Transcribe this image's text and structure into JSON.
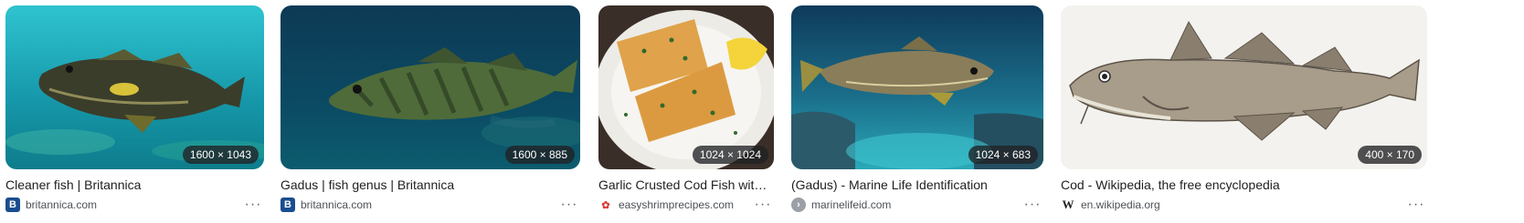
{
  "results": [
    {
      "dimensions": "1600 × 1043",
      "title": "Cleaner fish | Britannica",
      "source": "britannica.com",
      "favicon_glyph": "B",
      "favicon_bg": "#1a4d8f",
      "favicon_fg": "#ffffff",
      "favicon_icon": "britannica-favicon-icon"
    },
    {
      "dimensions": "1600 × 885",
      "title": "Gadus | fish genus | Britannica",
      "source": "britannica.com",
      "favicon_glyph": "B",
      "favicon_bg": "#1a4d8f",
      "favicon_fg": "#ffffff",
      "favicon_icon": "britannica-favicon-icon"
    },
    {
      "dimensions": "1024 × 1024",
      "title": "Garlic Crusted Cod Fish with a Li...",
      "source": "easyshrimprecipes.com",
      "favicon_glyph": "✿",
      "favicon_bg": "#ffffff",
      "favicon_fg": "#d93a3a",
      "favicon_icon": "shrimp-favicon-icon"
    },
    {
      "dimensions": "1024 × 683",
      "title": "(Gadus) - Marine Life Identification",
      "source": "marinelifeid.com",
      "favicon_glyph": "›",
      "favicon_bg": "#9aa0a6",
      "favicon_fg": "#ffffff",
      "favicon_icon": "generic-site-favicon-icon"
    },
    {
      "dimensions": "400 × 170",
      "title": "Cod - Wikipedia, the free encyclopedia",
      "source": "en.wikipedia.org",
      "favicon_glyph": "W",
      "favicon_bg": "#ffffff",
      "favicon_fg": "#202124",
      "favicon_icon": "wikipedia-favicon-icon"
    }
  ],
  "more_label": "···"
}
